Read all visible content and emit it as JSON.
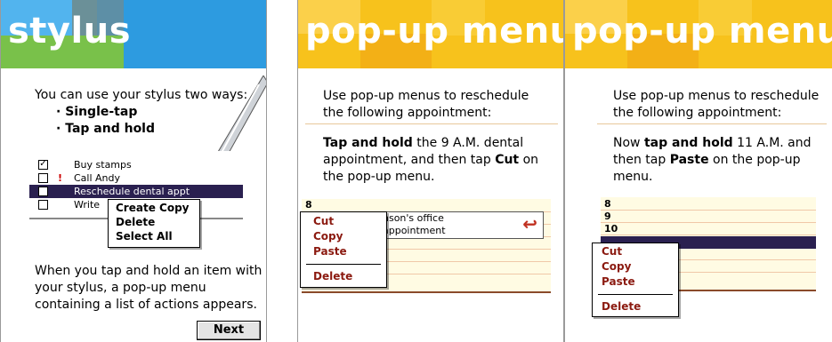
{
  "colors": {
    "stylus_banner": "#3aa0e0",
    "popup_banner": "#f7c21c",
    "menu_text": "#8b1a10",
    "highlight": "#2a2050"
  },
  "screen1": {
    "title": "stylus",
    "intro": "You can use your stylus two ways:",
    "bullets": [
      "Single-tap",
      "Tap and hold"
    ],
    "tasks": [
      {
        "label": "Buy stamps",
        "checked": true,
        "priority": ""
      },
      {
        "label": "Call Andy",
        "checked": false,
        "priority": "!"
      },
      {
        "label": "Reschedule dental appt",
        "checked": false,
        "priority": ""
      },
      {
        "label": "Write",
        "checked": false,
        "priority": ""
      }
    ],
    "menu": [
      "Create Copy",
      "Delete",
      "Select All"
    ],
    "footer": "When you tap and hold an item with your stylus, a pop-up menu containing a list of actions appears.",
    "next_button": "Next"
  },
  "screen2": {
    "title": "pop-up menus",
    "intro": "Use pop-up menus to reschedule the following appointment:",
    "instr_bold1": "Tap and hold",
    "instr_text1": " the 9 A.M. dental appointment, and then tap ",
    "instr_bold2": "Cut",
    "instr_text2": " on the pop-up menu.",
    "hour": "8",
    "appt_line1": "nson's office",
    "appt_line2": "appointment",
    "menu": [
      "Cut",
      "Copy",
      "Paste",
      "Delete"
    ]
  },
  "screen3": {
    "title": "pop-up menus",
    "intro": "Use pop-up menus to reschedule the following appointment:",
    "instr_text1": "Now ",
    "instr_bold1": "tap and hold",
    "instr_text2": " 11 A.M. and then tap ",
    "instr_bold2": "Paste",
    "instr_text3": " on the pop-up menu.",
    "hours": [
      "8",
      "9",
      "10"
    ],
    "menu": [
      "Cut",
      "Copy",
      "Paste",
      "Delete"
    ]
  }
}
